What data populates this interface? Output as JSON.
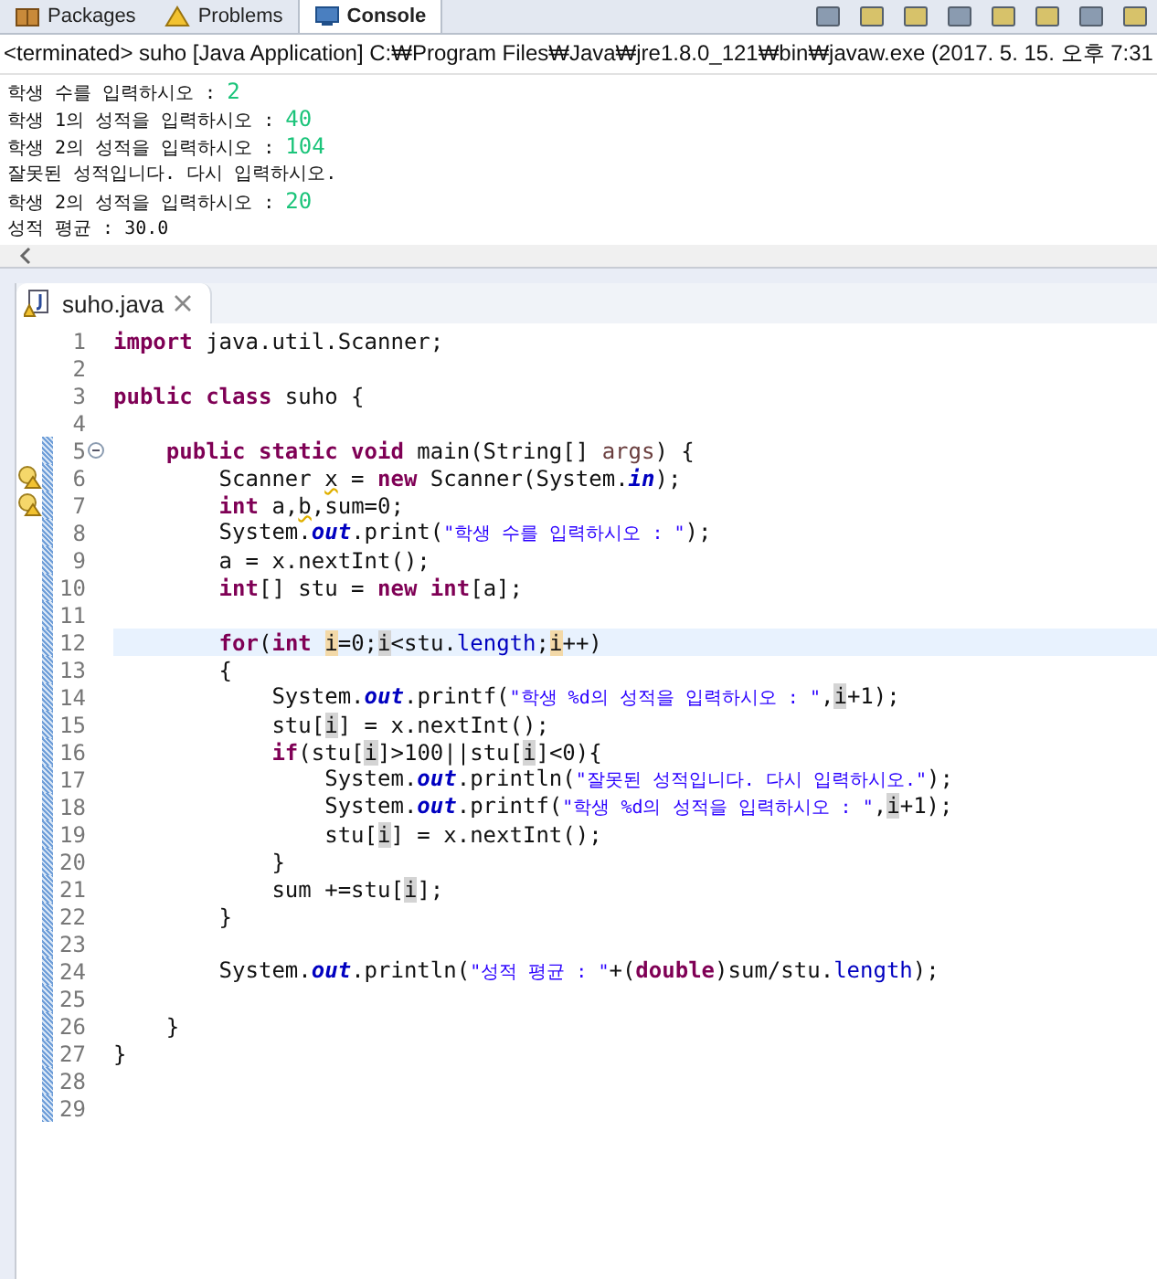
{
  "console_view": {
    "tabs": [
      {
        "label": "Packages",
        "selected": false
      },
      {
        "label": "Problems",
        "selected": false
      },
      {
        "label": "Console",
        "selected": true
      }
    ],
    "header": "<terminated> suho [Java Application] C:₩Program Files₩Java₩jre1.8.0_121₩bin₩javaw.exe (2017. 5. 15. 오후 7:31",
    "output": [
      {
        "text": "학생 수를 입력하시오 : ",
        "input": "2"
      },
      {
        "text": "학생 1의 성적을 입력하시오 : ",
        "input": "40"
      },
      {
        "text": "학생 2의 성적을 입력하시오 : ",
        "input": "104"
      },
      {
        "text": "잘못된 성적입니다. 다시 입력하시오."
      },
      {
        "text": "학생 2의 성적을 입력하시오 : ",
        "input": "20"
      },
      {
        "text": "성적 평균 : 30.0"
      }
    ]
  },
  "editor": {
    "tab": {
      "label": "suho.java",
      "selected": true
    },
    "lines": [
      {
        "number": "1",
        "changed": false,
        "current": false,
        "warning": false,
        "collapsible": false,
        "tokens": [
          {
            "kind": "kw",
            "text": "import"
          },
          {
            "kind": "plain",
            "text": " java.util.Scanner;"
          }
        ]
      },
      {
        "number": "2",
        "changed": false,
        "current": false,
        "warning": false,
        "collapsible": false
      },
      {
        "number": "3",
        "changed": false,
        "current": false,
        "warning": false,
        "collapsible": false,
        "tokens": [
          {
            "kind": "kw",
            "text": "public class"
          },
          {
            "kind": "plain",
            "text": " suho {"
          }
        ]
      },
      {
        "number": "4",
        "changed": false,
        "current": false,
        "warning": false,
        "collapsible": false
      },
      {
        "number": "5",
        "changed": true,
        "current": false,
        "warning": false,
        "collapsible": true,
        "tokens": [
          {
            "kind": "kw",
            "text": "    public static void"
          },
          {
            "kind": "plain",
            "text": " main(String[] "
          },
          {
            "kind": "param",
            "text": "args"
          },
          {
            "kind": "plain",
            "text": ") {"
          }
        ]
      },
      {
        "number": "6",
        "changed": true,
        "current": false,
        "warning": true,
        "collapsible": false,
        "tokens": [
          {
            "kind": "plain",
            "text": "        Scanner "
          },
          {
            "kind": "warn",
            "text": "x"
          },
          {
            "kind": "plain",
            "text": " = "
          },
          {
            "kind": "kw",
            "text": "new"
          },
          {
            "kind": "plain",
            "text": " Scanner(System."
          },
          {
            "kind": "field",
            "text": "in"
          },
          {
            "kind": "plain",
            "text": ");"
          }
        ]
      },
      {
        "number": "7",
        "changed": true,
        "current": false,
        "warning": true,
        "collapsible": false,
        "tokens": [
          {
            "kind": "kw",
            "text": "        int"
          },
          {
            "kind": "plain",
            "text": " a,"
          },
          {
            "kind": "warn",
            "text": "b"
          },
          {
            "kind": "plain",
            "text": ",sum=0;"
          }
        ]
      },
      {
        "number": "8",
        "changed": true,
        "current": false,
        "warning": false,
        "collapsible": false,
        "tokens": [
          {
            "kind": "plain",
            "text": "        System."
          },
          {
            "kind": "field",
            "text": "out"
          },
          {
            "kind": "plain",
            "text": ".print("
          },
          {
            "kind": "str",
            "text": "\"학생 수를 입력하시오 : \""
          },
          {
            "kind": "plain",
            "text": ");"
          }
        ]
      },
      {
        "number": "9",
        "changed": true,
        "current": false,
        "warning": false,
        "collapsible": false,
        "tokens": [
          {
            "kind": "plain",
            "text": "        a = x.nextInt();"
          }
        ]
      },
      {
        "number": "10",
        "changed": true,
        "current": false,
        "warning": false,
        "collapsible": false,
        "tokens": [
          {
            "kind": "kw",
            "text": "        int"
          },
          {
            "kind": "plain",
            "text": "[] stu = "
          },
          {
            "kind": "kw",
            "text": "new int"
          },
          {
            "kind": "plain",
            "text": "[a];"
          }
        ]
      },
      {
        "number": "11",
        "changed": true,
        "current": false,
        "warning": false,
        "collapsible": false
      },
      {
        "number": "12",
        "changed": true,
        "current": true,
        "warning": false,
        "collapsible": false,
        "tokens": [
          {
            "kind": "kw",
            "text": "        for"
          },
          {
            "kind": "plain",
            "text": "("
          },
          {
            "kind": "kw",
            "text": "int "
          },
          {
            "kind": "write",
            "text": "i"
          },
          {
            "kind": "plain",
            "text": "=0;"
          },
          {
            "kind": "read",
            "text": "i"
          },
          {
            "kind": "plain",
            "text": "<stu."
          },
          {
            "kind": "member",
            "text": "length"
          },
          {
            "kind": "plain",
            "text": ";"
          },
          {
            "kind": "write",
            "text": "i"
          },
          {
            "kind": "plain",
            "text": "++)"
          }
        ]
      },
      {
        "number": "13",
        "changed": true,
        "current": false,
        "warning": false,
        "collapsible": false,
        "tokens": [
          {
            "kind": "plain",
            "text": "        {"
          }
        ]
      },
      {
        "number": "14",
        "changed": true,
        "current": false,
        "warning": false,
        "collapsible": false,
        "tokens": [
          {
            "kind": "plain",
            "text": "            System."
          },
          {
            "kind": "field",
            "text": "out"
          },
          {
            "kind": "plain",
            "text": ".printf("
          },
          {
            "kind": "str",
            "text": "\"학생 %d의 성적을 입력하시오 : \""
          },
          {
            "kind": "plain",
            "text": ","
          },
          {
            "kind": "read",
            "text": "i"
          },
          {
            "kind": "plain",
            "text": "+1);"
          }
        ]
      },
      {
        "number": "15",
        "changed": true,
        "current": false,
        "warning": false,
        "collapsible": false,
        "tokens": [
          {
            "kind": "plain",
            "text": "            stu["
          },
          {
            "kind": "read",
            "text": "i"
          },
          {
            "kind": "plain",
            "text": "] = x.nextInt();"
          }
        ]
      },
      {
        "number": "16",
        "changed": true,
        "current": false,
        "warning": false,
        "collapsible": false,
        "tokens": [
          {
            "kind": "kw",
            "text": "            if"
          },
          {
            "kind": "plain",
            "text": "(stu["
          },
          {
            "kind": "read",
            "text": "i"
          },
          {
            "kind": "plain",
            "text": "]>100||stu["
          },
          {
            "kind": "read",
            "text": "i"
          },
          {
            "kind": "plain",
            "text": "]<0){"
          }
        ]
      },
      {
        "number": "17",
        "changed": true,
        "current": false,
        "warning": false,
        "collapsible": false,
        "tokens": [
          {
            "kind": "plain",
            "text": "                System."
          },
          {
            "kind": "field",
            "text": "out"
          },
          {
            "kind": "plain",
            "text": ".println("
          },
          {
            "kind": "str",
            "text": "\"잘못된 성적입니다. 다시 입력하시오.\""
          },
          {
            "kind": "plain",
            "text": ");"
          }
        ]
      },
      {
        "number": "18",
        "changed": true,
        "current": false,
        "warning": false,
        "collapsible": false,
        "tokens": [
          {
            "kind": "plain",
            "text": "                System."
          },
          {
            "kind": "field",
            "text": "out"
          },
          {
            "kind": "plain",
            "text": ".printf("
          },
          {
            "kind": "str",
            "text": "\"학생 %d의 성적을 입력하시오 : \""
          },
          {
            "kind": "plain",
            "text": ","
          },
          {
            "kind": "read",
            "text": "i"
          },
          {
            "kind": "plain",
            "text": "+1);"
          }
        ]
      },
      {
        "number": "19",
        "changed": true,
        "current": false,
        "warning": false,
        "collapsible": false,
        "tokens": [
          {
            "kind": "plain",
            "text": "                stu["
          },
          {
            "kind": "read",
            "text": "i"
          },
          {
            "kind": "plain",
            "text": "] = x.nextInt();"
          }
        ]
      },
      {
        "number": "20",
        "changed": true,
        "current": false,
        "warning": false,
        "collapsible": false,
        "tokens": [
          {
            "kind": "plain",
            "text": "            }"
          }
        ]
      },
      {
        "number": "21",
        "changed": true,
        "current": false,
        "warning": false,
        "collapsible": false,
        "tokens": [
          {
            "kind": "plain",
            "text": "            sum +=stu["
          },
          {
            "kind": "read",
            "text": "i"
          },
          {
            "kind": "plain",
            "text": "];"
          }
        ]
      },
      {
        "number": "22",
        "changed": true,
        "current": false,
        "warning": false,
        "collapsible": false,
        "tokens": [
          {
            "kind": "plain",
            "text": "        }"
          }
        ]
      },
      {
        "number": "23",
        "changed": true,
        "current": false,
        "warning": false,
        "collapsible": false
      },
      {
        "number": "24",
        "changed": true,
        "current": false,
        "warning": false,
        "collapsible": false,
        "tokens": [
          {
            "kind": "plain",
            "text": "        System."
          },
          {
            "kind": "field",
            "text": "out"
          },
          {
            "kind": "plain",
            "text": ".println("
          },
          {
            "kind": "str",
            "text": "\"성적 평균 : \""
          },
          {
            "kind": "plain",
            "text": "+("
          },
          {
            "kind": "kw",
            "text": "double"
          },
          {
            "kind": "plain",
            "text": ")sum/stu."
          },
          {
            "kind": "member",
            "text": "length"
          },
          {
            "kind": "plain",
            "text": ");"
          }
        ]
      },
      {
        "number": "25",
        "changed": true,
        "current": false,
        "warning": false,
        "collapsible": false
      },
      {
        "number": "26",
        "changed": true,
        "current": false,
        "warning": false,
        "collapsible": false,
        "tokens": [
          {
            "kind": "plain",
            "text": "    }"
          }
        ]
      },
      {
        "number": "27",
        "changed": true,
        "current": false,
        "warning": false,
        "collapsible": false,
        "tokens": [
          {
            "kind": "plain",
            "text": "}"
          }
        ]
      },
      {
        "number": "28",
        "changed": true,
        "current": false,
        "warning": false,
        "collapsible": false
      },
      {
        "number": "29",
        "changed": true,
        "current": false,
        "warning": false,
        "collapsible": false
      }
    ]
  }
}
